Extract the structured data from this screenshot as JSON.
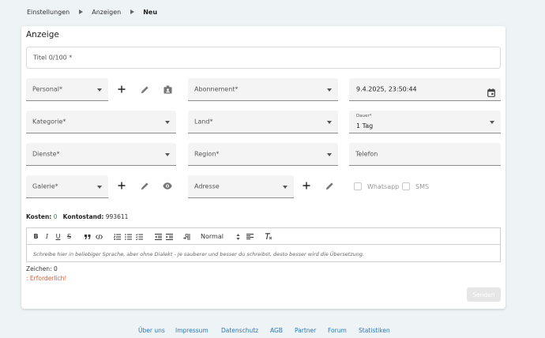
{
  "breadcrumb": {
    "items": [
      "Einstellungen",
      "Anzeigen"
    ],
    "current": "Neu"
  },
  "card": {
    "title": "Anzeige"
  },
  "form": {
    "title_placeholder": "Titel 0/100 *",
    "personal": "Personal*",
    "abonnement": "Abonnement*",
    "datetime": "9.4.2025, 23:50:44",
    "kategorie": "Kategorie*",
    "land": "Land*",
    "dauer_label": "Dauer*",
    "dauer_value": "1 Tag",
    "dienste": "Dienste*",
    "region": "Region*",
    "telefon": "Telefon",
    "galerie": "Galerie*",
    "adresse": "Adresse",
    "whatsapp": "Whatsapp",
    "sms": "SMS"
  },
  "costs": {
    "kosten_label": "Kosten:",
    "kosten_value": "0",
    "kontostand_label": "Kontostand:",
    "kontostand_value": "993611"
  },
  "editor": {
    "format_value": "Normal",
    "placeholder": "Schreibe hier in beliebiger Sprache, aber ohne Dialekt - Je sauberer und besser du schreibst, desto besser wird die Übersetzung."
  },
  "status": {
    "chars": "Zeichen: 0",
    "required": ": Erforderlich!"
  },
  "actions": {
    "send": "Senden"
  },
  "footer": {
    "links": [
      "Über uns",
      "Impressum",
      "Datenschutz",
      "AGB",
      "Partner",
      "Forum",
      "Statistiken"
    ]
  },
  "icons": {
    "add": "plus-icon",
    "edit": "pencil-icon",
    "badge": "id-badge-icon",
    "calendar": "calendar-icon",
    "eye": "eye-icon"
  },
  "colors": {
    "accent_green": "#3a8f3a",
    "error": "#e05a2b",
    "link": "#2a77b8"
  }
}
